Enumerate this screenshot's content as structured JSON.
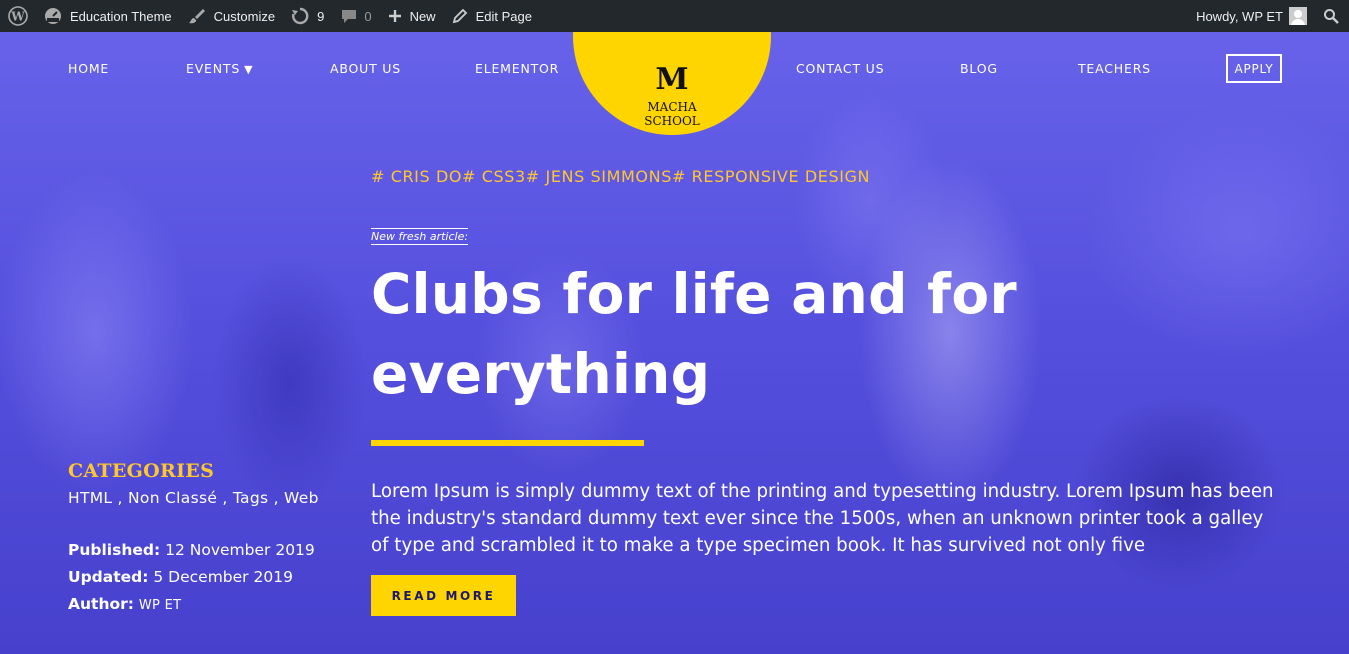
{
  "admin_bar": {
    "site_name": "Education Theme",
    "customize": "Customize",
    "updates_count": "9",
    "comments_count": "0",
    "new": "New",
    "edit_page": "Edit Page",
    "howdy": "Howdy, WP ET"
  },
  "nav": {
    "items": [
      "HOME",
      "EVENTS",
      "ABOUT US",
      "ELEMENTOR",
      "CONTACT US",
      "BLOG",
      "TEACHERS"
    ],
    "events_arrow": "▼",
    "apply": "APPLY"
  },
  "logo": {
    "mark": "M",
    "line1": "MACHA",
    "line2": "SCHOOL"
  },
  "post": {
    "tags": "# CRIS DO# CSS3# JENS SIMMONS# RESPONSIVE DESIGN",
    "kicker": "New fresh article:",
    "title": "Clubs for life and for everything",
    "excerpt": "Lorem Ipsum is simply dummy text of the printing and typesetting industry. Lorem Ipsum has been the industry's standard dummy text ever since the 1500s, when an unknown printer took a galley of type and scrambled it to make a type specimen book. It has survived not only five",
    "read_more": "READ MORE"
  },
  "sidebar": {
    "categories_title": "CATEGORIES",
    "categories": "HTML , Non Classé , Tags , Web",
    "published_label": "Published:",
    "published_value": "12 November 2019",
    "updated_label": "Updated:",
    "updated_value": "5 December 2019",
    "author_label": "Author:",
    "author_value": "WP ET"
  },
  "colors": {
    "accent": "#ffd500",
    "tag_yellow": "#ffc72c",
    "admin_bar": "#23282d",
    "overlay": "#5a55d8"
  }
}
